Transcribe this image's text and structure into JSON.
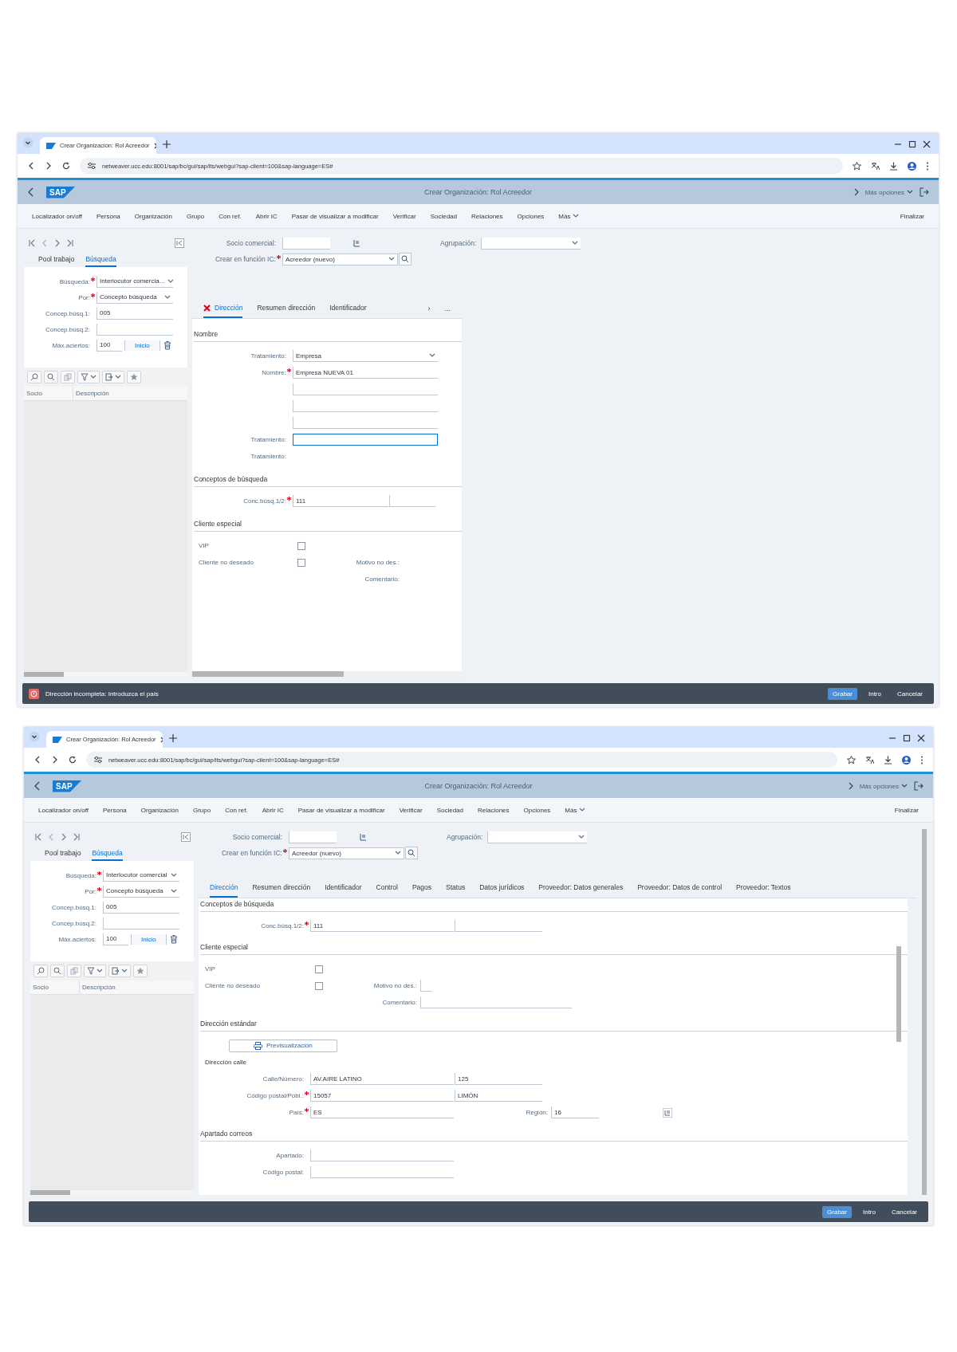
{
  "screens": [
    {
      "browser_tab": {
        "title": "Crear Organización: Rol Acreedor"
      },
      "url": "netweaver.ucc.edu:8001/sap/bc/gui/sap/its/webgui?sap-client=100&sap-language=ES#",
      "logo": "SAP",
      "app_title": "Crear Organización: Rol Acreedor",
      "user_menu": "Más opciones",
      "toolbar": [
        {
          "label": "Localizador on/off",
          "dropdown": false
        },
        {
          "label": "Persona",
          "dropdown": false
        },
        {
          "label": "Organización",
          "dropdown": false
        },
        {
          "label": "Grupo",
          "dropdown": false
        },
        {
          "label": "Con ref.",
          "dropdown": false
        },
        {
          "label": "Abrir IC",
          "dropdown": false
        },
        {
          "label": "Pasar de visualizar a modificar",
          "dropdown": false
        },
        {
          "label": "Verificar",
          "dropdown": false
        },
        {
          "label": "Sociedad",
          "dropdown": false
        },
        {
          "label": "Relaciones",
          "dropdown": false
        },
        {
          "label": "Opciones",
          "dropdown": false
        },
        {
          "label": "Más",
          "dropdown": true
        }
      ],
      "finish": "Finalizar",
      "left_panel": {
        "tabs": [
          {
            "label": "Pool trabajo",
            "selected": false
          },
          {
            "label": "Búsqueda",
            "selected": true
          }
        ],
        "fields": [
          {
            "label": "Búsqueda:",
            "required": true,
            "kind": "dropdown",
            "value": "Interlocutor comercia..."
          },
          {
            "label": "Por:",
            "required": true,
            "kind": "dropdown",
            "value": "Concepto búsqueda"
          },
          {
            "label": "Concep.búsq.1:",
            "required": false,
            "kind": "input",
            "value": "005"
          },
          {
            "label": "Concep.búsq.2:",
            "required": false,
            "kind": "input"
          }
        ],
        "max_hits": {
          "label": "Máx.aciertos:",
          "value": "100"
        },
        "start_button": "Inicio",
        "columns": [
          "Socio",
          "Descripción"
        ]
      },
      "header": {
        "partner_label": "Socio comercial:",
        "grouping_label": "Agrupación:",
        "role_label": "Crear en función IC:",
        "role_value": "Acreedor (nuevo)"
      },
      "tabs": [
        {
          "label": "Dirección",
          "selected": true,
          "error": true
        },
        {
          "label": "Resumen dirección",
          "selected": false,
          "error": false
        },
        {
          "label": "Identificador",
          "selected": false,
          "error": false
        }
      ],
      "tab_scroll": "›",
      "tab_overflow": "...",
      "sections": [
        {
          "title": "Nombre",
          "rows": [
            {
              "kind": "field",
              "label": "Tratamiento:",
              "required": false,
              "inputs": [
                {
                  "value": "Empresa",
                  "focused": false,
                  "dropdown": true
                }
              ]
            },
            {
              "kind": "field",
              "label": "Nombre:",
              "required": true,
              "inputs": [
                {
                  "value": "Empresa NUEVA 01",
                  "focused": false,
                  "dropdown": false
                }
              ]
            },
            {
              "kind": "field",
              "required": false,
              "inputs": [
                {
                  "focused": false,
                  "dropdown": false
                }
              ]
            },
            {
              "kind": "field",
              "required": false,
              "inputs": [
                {
                  "focused": false,
                  "dropdown": false
                }
              ]
            },
            {
              "kind": "field",
              "required": false,
              "inputs": [
                {
                  "focused": false,
                  "dropdown": false
                }
              ]
            },
            {
              "kind": "field",
              "label": "Tratamiento:",
              "required": false,
              "inputs": [
                {
                  "focused": true,
                  "dropdown": false
                }
              ]
            },
            {
              "kind": "field",
              "label": "Tratamiento:",
              "required": false,
              "inputs": []
            }
          ]
        },
        {
          "title": "Conceptos de búsqueda",
          "rows": [
            {
              "kind": "field",
              "label": "Conc.búsq.1/2:",
              "required": true,
              "inputs": [
                {
                  "value": "111",
                  "focused": false,
                  "dropdown": false
                },
                {
                  "focused": false,
                  "dropdown": false
                }
              ]
            }
          ]
        },
        {
          "title": "Cliente especial",
          "rows": [
            {
              "kind": "checkbox",
              "label": "VIP",
              "checked": false
            },
            {
              "kind": "checkbox",
              "label": "Cliente no deseado",
              "checked": false,
              "side_label": "Motivo no des.:",
              "side_input": false
            },
            {
              "kind": "side_field",
              "label": "Comentario:",
              "side_input": false
            }
          ]
        }
      ],
      "message": "Dirección incompleta: Introduzca el país",
      "buttons": [
        {
          "label": "Grabar",
          "primary": true
        },
        {
          "label": "Intro",
          "primary": false
        },
        {
          "label": "Cancelar",
          "primary": false
        }
      ]
    },
    {
      "browser_tab": {
        "title": "Crear Organización: Rol Acreedor"
      },
      "url": "netweaver.ucc.edu:8001/sap/bc/gui/sap/its/webgui?sap-client=100&sap-language=ES#",
      "logo": "SAP",
      "app_title": "Crear Organización: Rol Acreedor",
      "user_menu": "Más opciones",
      "toolbar": [
        {
          "label": "Localizador on/off",
          "dropdown": false
        },
        {
          "label": "Persona",
          "dropdown": false
        },
        {
          "label": "Organización",
          "dropdown": false
        },
        {
          "label": "Grupo",
          "dropdown": false
        },
        {
          "label": "Con ref.",
          "dropdown": false
        },
        {
          "label": "Abrir IC",
          "dropdown": false
        },
        {
          "label": "Pasar de visualizar a modificar",
          "dropdown": false
        },
        {
          "label": "Verificar",
          "dropdown": false
        },
        {
          "label": "Sociedad",
          "dropdown": false
        },
        {
          "label": "Relaciones",
          "dropdown": false
        },
        {
          "label": "Opciones",
          "dropdown": false
        },
        {
          "label": "Más",
          "dropdown": true
        }
      ],
      "finish": "Finalizar",
      "left_panel": {
        "tabs": [
          {
            "label": "Pool trabajo",
            "selected": false
          },
          {
            "label": "Búsqueda",
            "selected": true
          }
        ],
        "fields": [
          {
            "label": "Búsqueda:",
            "required": true,
            "kind": "dropdown",
            "value": "Interlocutor comercial"
          },
          {
            "label": "Por:",
            "required": true,
            "kind": "dropdown",
            "value": "Concepto búsqueda"
          },
          {
            "label": "Concep.búsq.1:",
            "required": false,
            "kind": "input",
            "value": "005"
          },
          {
            "label": "Concep.búsq.2:",
            "required": false,
            "kind": "input"
          }
        ],
        "max_hits": {
          "label": "Máx.aciertos:",
          "value": "100"
        },
        "start_button": "Inicio",
        "columns": [
          "Socio",
          "Descripción"
        ]
      },
      "header": {
        "partner_label": "Socio comercial:",
        "grouping_label": "Agrupación:",
        "role_label": "Crear en función IC:",
        "role_value": "Acreedor (nuevo)"
      },
      "tabs": [
        {
          "label": "Dirección",
          "selected": true,
          "error": false
        },
        {
          "label": "Resumen dirección",
          "selected": false,
          "error": false
        },
        {
          "label": "Identificador",
          "selected": false,
          "error": false
        },
        {
          "label": "Control",
          "selected": false,
          "error": false
        },
        {
          "label": "Pagos",
          "selected": false,
          "error": false
        },
        {
          "label": "Status",
          "selected": false,
          "error": false
        },
        {
          "label": "Datos jurídicos",
          "selected": false,
          "error": false
        },
        {
          "label": "Proveedor: Datos generales",
          "selected": false,
          "error": false
        },
        {
          "label": "Proveedor: Datos de control",
          "selected": false,
          "error": false
        },
        {
          "label": "Proveedor: Textos",
          "selected": false,
          "error": false
        }
      ],
      "sections": [
        {
          "title": "Conceptos de búsqueda",
          "rows": [
            {
              "kind": "field",
              "label": "Conc.búsq.1/2:",
              "required": true,
              "inputs": [
                {
                  "value": "111",
                  "focused": false,
                  "dropdown": false
                },
                {
                  "focused": false,
                  "dropdown": false
                }
              ]
            }
          ]
        },
        {
          "title": "Cliente especial",
          "rows": [
            {
              "kind": "checkbox",
              "label": "VIP",
              "checked": false
            },
            {
              "kind": "checkbox",
              "label": "Cliente no deseado",
              "checked": false,
              "side_label": "Motivo no des.:",
              "side_input": true
            },
            {
              "kind": "side_field",
              "label": "Comentario:",
              "side_input": true
            }
          ]
        },
        {
          "title": "Dirección estándar",
          "rows": [
            {
              "kind": "button",
              "label": "Previsualización"
            },
            {
              "kind": "heading",
              "label": "Dirección calle"
            },
            {
              "kind": "field",
              "label": "Calle/Número:",
              "required": false,
              "inputs": [
                {
                  "value": "AV.AIRE LATINO",
                  "focused": false,
                  "dropdown": false
                },
                {
                  "value": "125",
                  "focused": false,
                  "dropdown": false
                }
              ]
            },
            {
              "kind": "field",
              "label": "Código postal/Pobl.:",
              "required": true,
              "inputs": [
                {
                  "value": "15057",
                  "focused": false,
                  "dropdown": false
                },
                {
                  "value": "LIMÓN",
                  "focused": false,
                  "dropdown": false
                }
              ]
            },
            {
              "kind": "field",
              "label": "País:",
              "required": true,
              "inputs": [
                {
                  "value": "ES",
                  "focused": false,
                  "dropdown": false
                }
              ],
              "side_label": "Región:",
              "side_value": "16"
            }
          ]
        },
        {
          "title": "Apartado correos",
          "rows": [
            {
              "kind": "field",
              "label": "Apartado:",
              "required": false,
              "inputs": [
                {
                  "focused": false,
                  "dropdown": false
                }
              ]
            },
            {
              "kind": "field",
              "label": "Código postal:",
              "required": false,
              "inputs": [
                {
                  "focused": false,
                  "dropdown": false
                }
              ]
            }
          ]
        }
      ],
      "buttons": [
        {
          "label": "Grabar",
          "primary": true
        },
        {
          "label": "Intro",
          "primary": false
        },
        {
          "label": "Cancelar",
          "primary": false
        }
      ]
    }
  ]
}
